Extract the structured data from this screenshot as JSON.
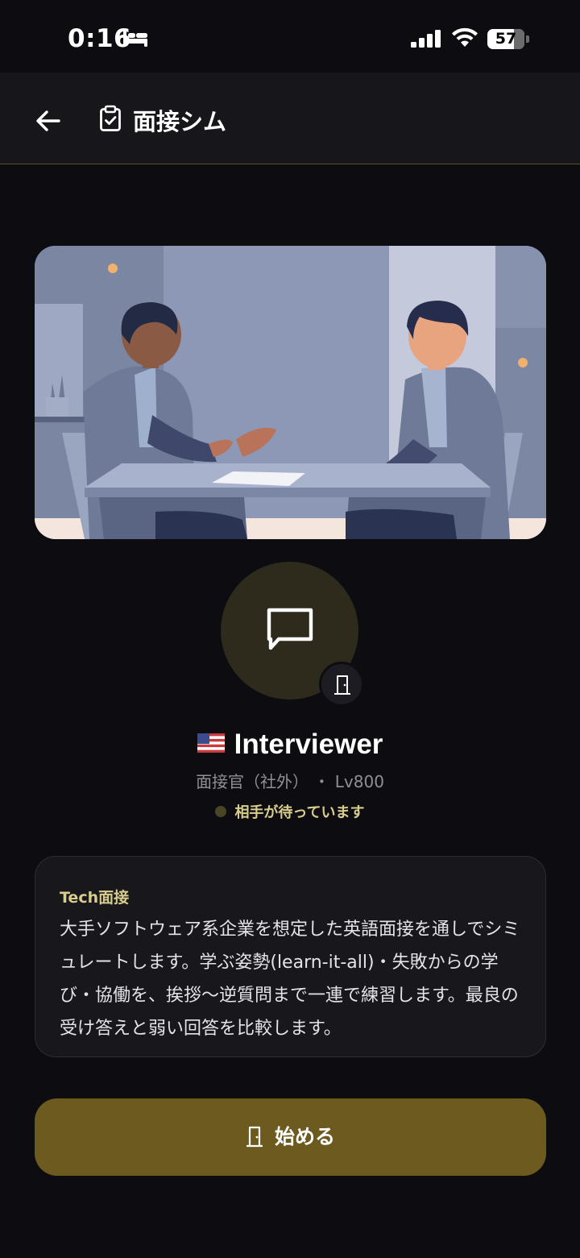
{
  "status_bar": {
    "time": "0:16",
    "battery": "57"
  },
  "header": {
    "title": "面接シム"
  },
  "interviewer": {
    "name": "Interviewer",
    "role": "面接官（社外） ・ Lv800",
    "status": "相手が待っています"
  },
  "card": {
    "title": "Tech面接",
    "body": "大手ソフトウェア系企業を想定した英語面接を通しでシミュレートします。学ぶ姿勢(learn-it-all)・失敗からの学び・協働を、挨拶〜逆質問まで一連で練習します。最良の受け答えと弱い回答を比較します。"
  },
  "start_button": {
    "label": "始める"
  },
  "colors": {
    "background": "#0d0d11",
    "accent": "#6c5a1f",
    "accent_text": "#d8cd8c"
  },
  "icons": [
    "bed-icon",
    "signal-icon",
    "wifi-icon",
    "back-arrow-icon",
    "clipboard-check-icon",
    "chat-bubble-icon",
    "door-icon",
    "us-flag-icon"
  ]
}
